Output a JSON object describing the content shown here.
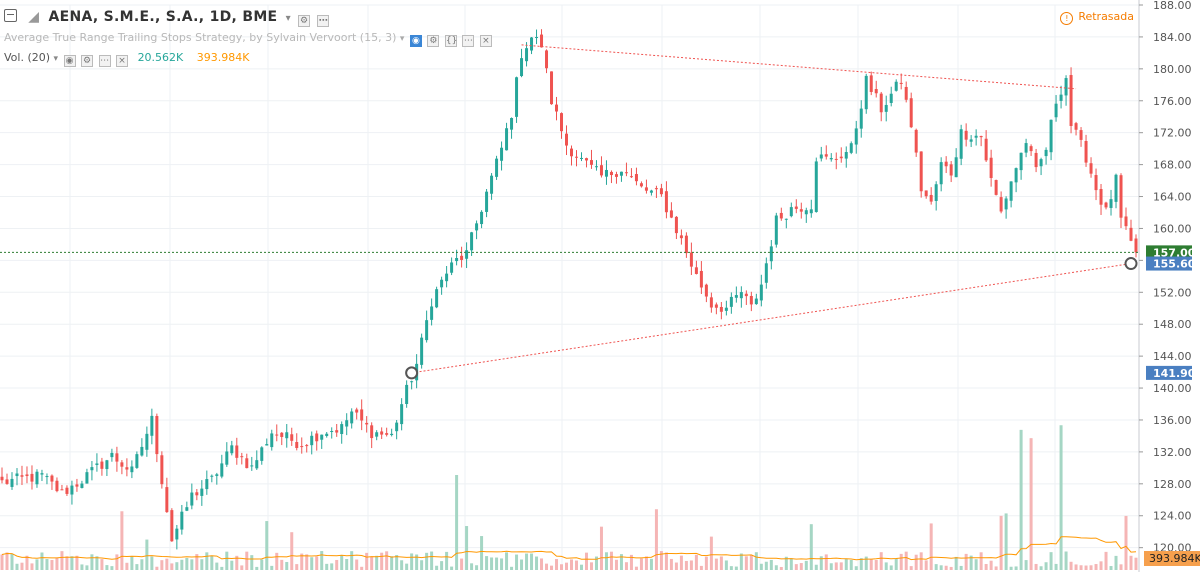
{
  "header": {
    "symbol_line": "AENA, S.M.E., S.A., 1D, BME",
    "strategy_line": "Average True Range Trailing Stops Strategy, by Sylvain Vervoort (15, 3)",
    "volume_label": "Vol. (20)",
    "volume_value": "20.562K",
    "volume_ma_value": "393.984K",
    "delayed_label": "Retrasada"
  },
  "colors": {
    "up": "#26a69a",
    "down": "#ef5350",
    "volume_up": "#a5d6c4",
    "volume_down": "#f5b5b5",
    "volume_ma": "#ff9800",
    "last_price": "#2e7d32",
    "marker_label": "#4a7fc1",
    "trendline": "#ef5350"
  },
  "chart_data": {
    "type": "candlestick",
    "y_axis": {
      "ticks": [
        "188.00",
        "184.00",
        "180.00",
        "176.00",
        "172.00",
        "168.00",
        "164.00",
        "160.00",
        "156.00",
        "152.00",
        "148.00",
        "144.00",
        "140.00",
        "136.00",
        "132.00",
        "128.00",
        "124.00",
        "120.00"
      ],
      "min": 117.2,
      "max": 188.0
    },
    "price_labels": [
      {
        "value": 157.0,
        "text": "157.00",
        "style": "last_price"
      },
      {
        "value": 155.6,
        "text": "155.60",
        "style": "marker"
      },
      {
        "value": 141.9,
        "text": "141.90",
        "style": "marker"
      }
    ],
    "volume_badge": "393.984K",
    "bar_count": 228,
    "waypoints": [
      [
        0,
        128.2
      ],
      [
        8,
        129.0
      ],
      [
        12,
        126.8
      ],
      [
        16,
        128.5
      ],
      [
        22,
        131.5
      ],
      [
        26,
        129.5
      ],
      [
        30,
        136.0
      ],
      [
        34,
        121.0
      ],
      [
        38,
        126.5
      ],
      [
        42,
        128.5
      ],
      [
        46,
        132.5
      ],
      [
        50,
        130.0
      ],
      [
        54,
        134.5
      ],
      [
        60,
        133.0
      ],
      [
        64,
        134.5
      ],
      [
        68,
        135.0
      ],
      [
        70,
        137.0
      ],
      [
        74,
        134.5
      ],
      [
        78,
        134.0
      ],
      [
        80,
        138.0
      ],
      [
        83,
        143.0
      ],
      [
        86,
        151.0
      ],
      [
        89,
        154.5
      ],
      [
        91,
        156.0
      ],
      [
        93,
        156.8
      ],
      [
        97,
        164.5
      ],
      [
        100,
        170.0
      ],
      [
        102,
        174.5
      ],
      [
        104,
        182.0
      ],
      [
        106,
        184.0
      ],
      [
        108,
        183.0
      ],
      [
        110,
        176.0
      ],
      [
        113,
        170.5
      ],
      [
        116,
        168.5
      ],
      [
        120,
        166.5
      ],
      [
        124,
        167.5
      ],
      [
        128,
        165.0
      ],
      [
        132,
        164.0
      ],
      [
        136,
        158.5
      ],
      [
        139,
        154.0
      ],
      [
        142,
        150.5
      ],
      [
        145,
        150.0
      ],
      [
        148,
        152.0
      ],
      [
        150,
        150.0
      ],
      [
        152,
        153.0
      ],
      [
        155,
        161.0
      ],
      [
        158,
        162.5
      ],
      [
        162,
        163.0
      ],
      [
        163,
        169.0
      ],
      [
        166,
        168.5
      ],
      [
        170,
        170.0
      ],
      [
        173,
        178.5
      ],
      [
        176,
        175.0
      ],
      [
        180,
        178.5
      ],
      [
        182,
        173.0
      ],
      [
        184,
        165.0
      ],
      [
        186,
        163.0
      ],
      [
        188,
        168.0
      ],
      [
        190,
        167.0
      ],
      [
        192,
        172.0
      ],
      [
        196,
        171.5
      ],
      [
        198,
        166.0
      ],
      [
        200,
        162.0
      ],
      [
        202,
        166.0
      ],
      [
        205,
        171.0
      ],
      [
        207,
        167.0
      ],
      [
        209,
        170.0
      ],
      [
        211,
        176.0
      ],
      [
        213,
        179.0
      ],
      [
        214,
        173.0
      ],
      [
        217,
        169.0
      ],
      [
        219,
        165.0
      ],
      [
        221,
        162.0
      ],
      [
        223,
        166.0
      ],
      [
        224,
        161.0
      ],
      [
        226,
        158.0
      ],
      [
        227,
        157.0
      ]
    ],
    "trendlines": [
      {
        "name": "upper",
        "from": [
          104,
          183.0
        ],
        "to": [
          215,
          177.5
        ]
      },
      {
        "name": "lower",
        "from": [
          82,
          141.9
        ],
        "to": [
          226,
          155.6
        ]
      }
    ],
    "markers": [
      {
        "name": "marker-low",
        "bar": 82,
        "value": 141.9
      },
      {
        "name": "marker-last",
        "bar": 226,
        "value": 155.6
      }
    ],
    "volume_ma_level": "around 393.984K",
    "volume_spikes_bars": [
      204,
      206,
      212,
      91
    ]
  }
}
